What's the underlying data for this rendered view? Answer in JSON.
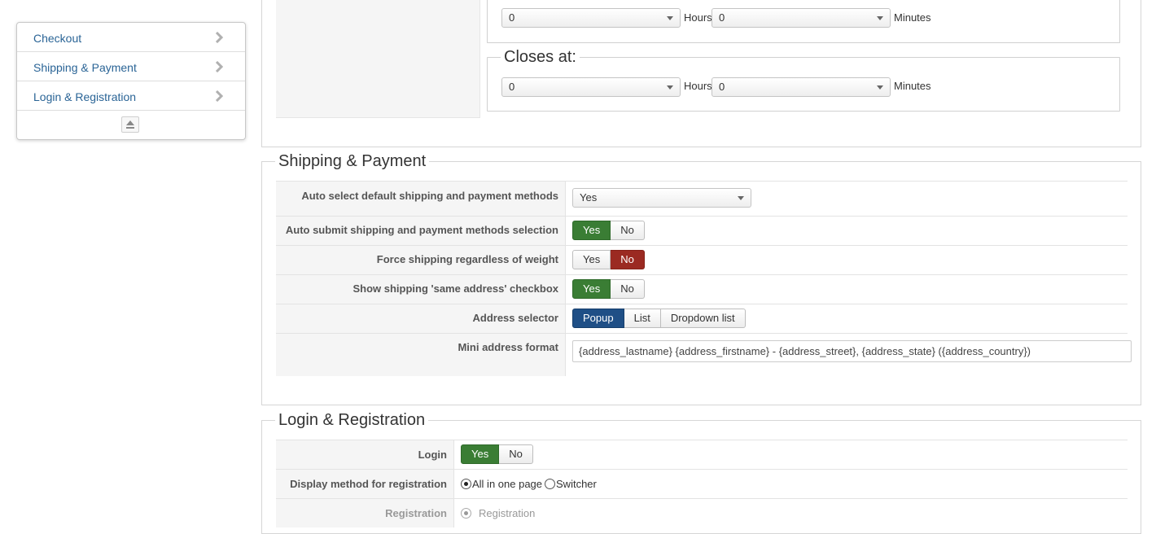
{
  "sidebar": {
    "items": [
      {
        "label": "Checkout"
      },
      {
        "label": "Shipping & Payment"
      },
      {
        "label": "Login & Registration"
      }
    ]
  },
  "hours_block": {
    "opens": {
      "hours_value": "0",
      "hours_unit": "Hours",
      "minutes_value": "0",
      "minutes_unit": "Minutes"
    },
    "closes_legend": "Closes at:",
    "closes": {
      "hours_value": "0",
      "hours_unit": "Hours",
      "minutes_value": "0",
      "minutes_unit": "Minutes"
    }
  },
  "shipping": {
    "title": "Shipping & Payment",
    "auto_select": {
      "label": "Auto select default shipping and payment methods",
      "value": "Yes"
    },
    "auto_submit": {
      "label": "Auto submit shipping and payment methods selection",
      "yes": "Yes",
      "no": "No",
      "selected": "Yes"
    },
    "force_shipping": {
      "label": "Force shipping regardless of weight",
      "yes": "Yes",
      "no": "No",
      "selected": "No"
    },
    "same_address": {
      "label": "Show shipping 'same address' checkbox",
      "yes": "Yes",
      "no": "No",
      "selected": "Yes"
    },
    "address_selector": {
      "label": "Address selector",
      "options": [
        "Popup",
        "List",
        "Dropdown list"
      ],
      "selected": "Popup"
    },
    "mini_address": {
      "label": "Mini address format",
      "value": "{address_lastname} {address_firstname} - {address_street}, {address_state} ({address_country})"
    }
  },
  "login": {
    "title": "Login & Registration",
    "login": {
      "label": "Login",
      "yes": "Yes",
      "no": "No",
      "selected": "Yes"
    },
    "display_method": {
      "label": "Display method for registration",
      "opt1": "All in one page",
      "opt2": "Switcher",
      "selected": "All in one page"
    },
    "registration": {
      "label": "Registration",
      "opt1": "Registration"
    }
  },
  "colors": {
    "yes_active": "#3a7d34",
    "no_active": "#9b2a22",
    "popup_active": "#1f4f86",
    "link": "#2a6496"
  }
}
